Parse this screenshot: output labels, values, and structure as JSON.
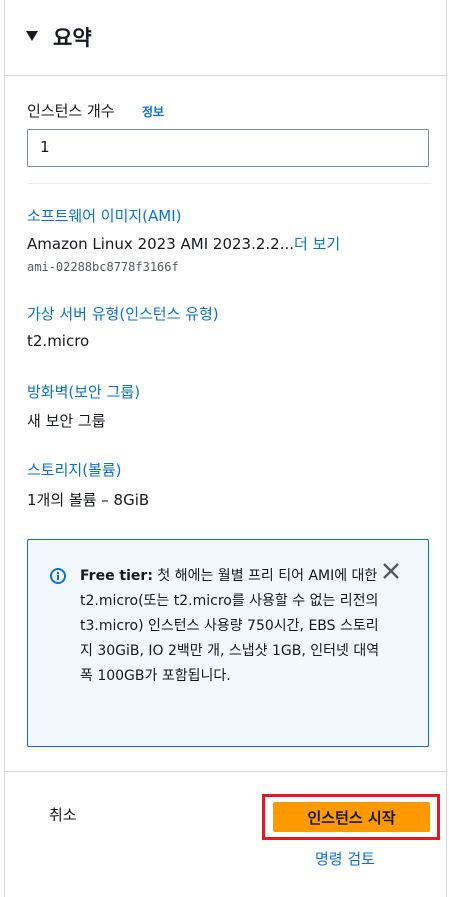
{
  "header": {
    "title": "요약"
  },
  "instance_count": {
    "label": "인스턴스 개수",
    "info": "정보",
    "value": "1"
  },
  "ami": {
    "label": "소프트웨어 이미지(AMI)",
    "name": "Amazon Linux 2023 AMI 2023.2.2...",
    "more": "더 보기",
    "id": "ami-02288bc8778f3166f"
  },
  "instance_type": {
    "label": "가상 서버 유형(인스턴스 유형)",
    "value": "t2.micro"
  },
  "firewall": {
    "label": "방화벽(보안 그룹)",
    "value": "새 보안 그룹"
  },
  "storage": {
    "label": "스토리지(볼륨)",
    "value": "1개의 볼륨 – 8GiB"
  },
  "alert": {
    "bold": "Free tier:",
    "text": " 첫 해에는 월별 프리 티어 AMI에 대한 t2.micro(또는 t2.micro를 사용할 수 없는 리전의 t3.micro) 인스턴스 사용량 750시간, EBS 스토리지 30GiB, IO 2백만 개, 스냅샷 1GB, 인터넷 대역폭 100GB가 포함됩니다.",
    "color": "#0972d3"
  },
  "footer": {
    "cancel": "취소",
    "launch": "인스턴스 시작",
    "review": "명령 검토",
    "launch_color": "#ff9900",
    "highlight_color": "#e01b24"
  }
}
